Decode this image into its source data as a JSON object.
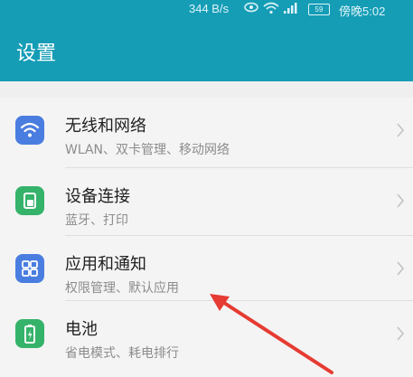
{
  "status": {
    "speed": "344 B/s",
    "battery": "59",
    "time": "傍晚5:02"
  },
  "header": {
    "title": "设置"
  },
  "items": [
    {
      "label": "无线和网络",
      "sub": "WLAN、双卡管理、移动网络",
      "icon": "wifi-icon",
      "color": "#4a7de0"
    },
    {
      "label": "设备连接",
      "sub": "蓝牙、打印",
      "icon": "device-connection-icon",
      "color": "#35b36a"
    },
    {
      "label": "应用和通知",
      "sub": "权限管理、默认应用",
      "icon": "apps-grid-icon",
      "color": "#4a7de0"
    },
    {
      "label": "电池",
      "sub": "省电模式、耗电排行",
      "icon": "battery-icon",
      "color": "#35b36a"
    }
  ]
}
